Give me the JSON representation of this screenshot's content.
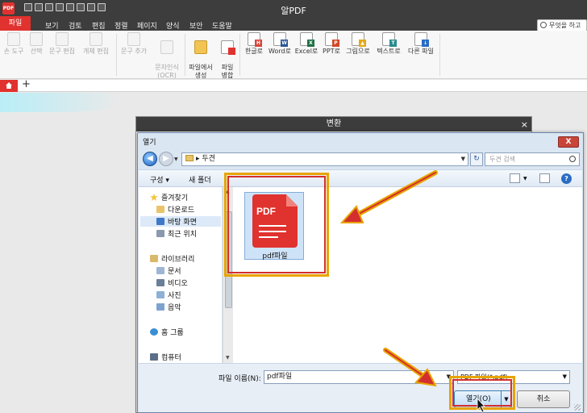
{
  "app": {
    "logo": "PDF",
    "title": "알PDF"
  },
  "menu": {
    "file_tab": "파일",
    "items": [
      "보기",
      "검토",
      "편집",
      "정렬",
      "페이지",
      "양식",
      "보안",
      "도움말"
    ],
    "search_label": "무엇을 하고"
  },
  "ribbon": {
    "buttons": [
      {
        "label": "손 도구",
        "icon": "hand-icon",
        "enabled": false
      },
      {
        "label": "선택",
        "icon": "select-icon",
        "enabled": false
      },
      {
        "label": "문구 편집",
        "icon": "text-edit-icon",
        "enabled": false
      },
      {
        "label": "개체 편집",
        "icon": "object-edit-icon",
        "enabled": false
      },
      {
        "label": "문구 추가",
        "icon": "text-add-icon",
        "enabled": false
      },
      {
        "label": "문자인식\n(OCR)",
        "icon": "ocr-icon",
        "enabled": false
      },
      {
        "label": "파일에서\n생성",
        "icon": "folder-icon",
        "enabled": true
      },
      {
        "label": "파일\n병합",
        "icon": "merge-icon",
        "enabled": true
      },
      {
        "label": "한글로",
        "icon": "hwp-icon",
        "enabled": true,
        "tag": "H",
        "color": "#d9453a"
      },
      {
        "label": "Word로",
        "icon": "word-icon",
        "enabled": true,
        "tag": "W",
        "color": "#2b5797"
      },
      {
        "label": "Excel로",
        "icon": "excel-icon",
        "enabled": true,
        "tag": "X",
        "color": "#1e7145"
      },
      {
        "label": "PPT로",
        "icon": "ppt-icon",
        "enabled": true,
        "tag": "P",
        "color": "#d24726"
      },
      {
        "label": "그림으로",
        "icon": "image-icon",
        "enabled": true,
        "tag": "▲",
        "color": "#e6a817"
      },
      {
        "label": "텍스트로",
        "icon": "text-icon",
        "enabled": true,
        "tag": "T",
        "color": "#2a8c8c"
      },
      {
        "label": "다른 파일",
        "icon": "other-file-icon",
        "enabled": true,
        "tag": "↓",
        "color": "#2a6cc4"
      }
    ]
  },
  "convert_window": {
    "title": "변환",
    "close": "×"
  },
  "open_dialog": {
    "title": "열기",
    "close": "X",
    "path": "두견",
    "search_placeholder": "두견 검색",
    "toolbar": {
      "organize": "구성 ▾",
      "new_folder": "새 폴더"
    },
    "nav": {
      "favorites": "즐겨찾기",
      "downloads": "다운로드",
      "desktop": "바탕 화면",
      "recent": "최근 위치",
      "libraries": "라이브러리",
      "documents": "문서",
      "videos": "비디오",
      "pictures": "사진",
      "music": "음악",
      "homegroup": "홈 그룹",
      "computer": "컴퓨터"
    },
    "file": {
      "icon_text": "PDF",
      "name": "pdf파일"
    },
    "footer": {
      "filename_label": "파일 이름(N):",
      "filename_value": "pdf파일",
      "filetype": "PDF 파일(*.pdf)",
      "open_button": "열기(O)",
      "cancel_button": "취소"
    }
  },
  "colors": {
    "brand": "#e0322e",
    "highlight_outer": "#e8a400",
    "highlight_inner": "#d32f2f"
  }
}
